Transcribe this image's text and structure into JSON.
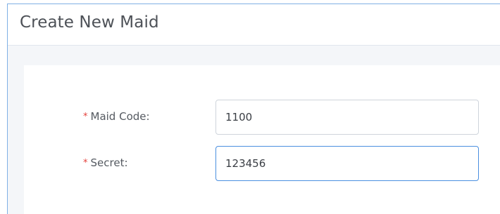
{
  "dialog": {
    "title": "Create New Maid"
  },
  "form": {
    "maid_code": {
      "required_mark": "*",
      "label": "Maid Code:",
      "value": "1100"
    },
    "secret": {
      "required_mark": "*",
      "label": "Secret:",
      "value": "123456"
    }
  },
  "colors": {
    "required_mark": "#e5413c",
    "focused_border": "#4a8fe0",
    "window_border": "#7fb0e5"
  }
}
